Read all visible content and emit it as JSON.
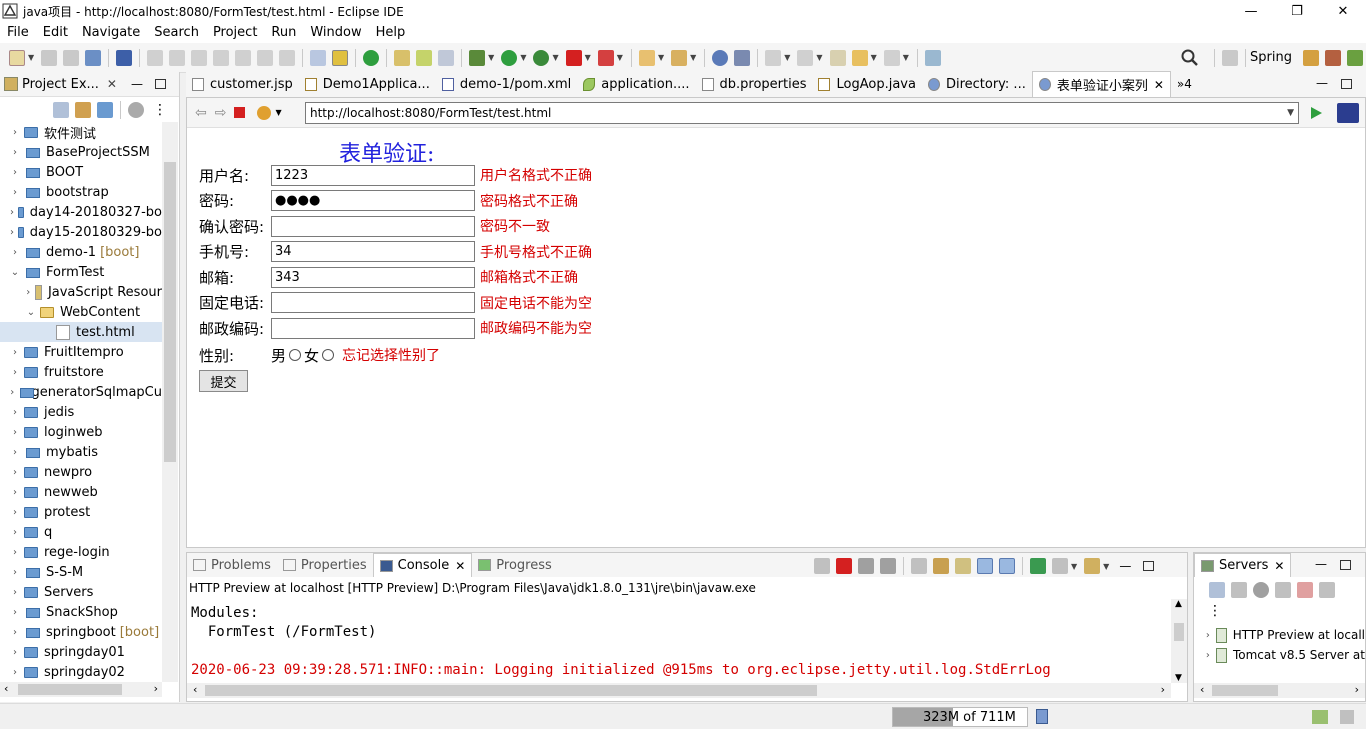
{
  "window": {
    "title": "java项目 - http://localhost:8080/FormTest/test.html - Eclipse IDE",
    "minimize": "—",
    "restore": "❐",
    "close": "✕"
  },
  "menu": [
    "File",
    "Edit",
    "Navigate",
    "Search",
    "Project",
    "Run",
    "Window",
    "Help"
  ],
  "perspective": {
    "label": "Spring"
  },
  "left_view": {
    "tab": "Project Ex...",
    "items": [
      {
        "label": "软件测试",
        "type": "folder",
        "twisty": "›"
      },
      {
        "label": "BaseProjectSSM",
        "type": "project",
        "twisty": "›"
      },
      {
        "label": "BOOT",
        "type": "project",
        "twisty": "›"
      },
      {
        "label": "bootstrap",
        "type": "project",
        "twisty": "›"
      },
      {
        "label": "day14-20180327-bo",
        "type": "folder",
        "twisty": "›"
      },
      {
        "label": "day15-20180329-bo",
        "type": "folder",
        "twisty": "›"
      },
      {
        "label": "demo-1",
        "suffix": "[boot]",
        "type": "project",
        "twisty": "›"
      },
      {
        "label": "FormTest",
        "type": "project",
        "twisty": "⌄"
      },
      {
        "label": "JavaScript Resour",
        "type": "jsres",
        "twisty": "›",
        "indent": 1
      },
      {
        "label": "WebContent",
        "type": "openfolder",
        "twisty": "⌄",
        "indent": 1
      },
      {
        "label": "test.html",
        "type": "file",
        "twisty": "",
        "indent": 2,
        "selected": true
      },
      {
        "label": "FruitItempro",
        "type": "folder",
        "twisty": "›"
      },
      {
        "label": "fruitstore",
        "type": "folder",
        "twisty": "›"
      },
      {
        "label": "generatorSqlmapCu",
        "type": "project",
        "twisty": "›"
      },
      {
        "label": "jedis",
        "type": "folder",
        "twisty": "›"
      },
      {
        "label": "loginweb",
        "type": "folder",
        "twisty": "›"
      },
      {
        "label": "mybatis",
        "type": "project",
        "twisty": "›"
      },
      {
        "label": "newpro",
        "type": "folder",
        "twisty": "›"
      },
      {
        "label": "newweb",
        "type": "folder",
        "twisty": "›"
      },
      {
        "label": "protest",
        "type": "folder",
        "twisty": "›"
      },
      {
        "label": "q",
        "type": "folder",
        "twisty": "›"
      },
      {
        "label": "rege-login",
        "type": "folder",
        "twisty": "›"
      },
      {
        "label": "S-S-M",
        "type": "project",
        "twisty": "›"
      },
      {
        "label": "Servers",
        "type": "folder",
        "twisty": "›"
      },
      {
        "label": "SnackShop",
        "type": "project",
        "twisty": "›"
      },
      {
        "label": "springboot",
        "suffix": "[boot]",
        "type": "project",
        "twisty": "›"
      },
      {
        "label": "springday01",
        "type": "folder",
        "twisty": "›"
      },
      {
        "label": "springday02",
        "type": "folder",
        "twisty": "›"
      }
    ]
  },
  "editor_tabs": [
    {
      "label": "customer.jsp",
      "active": false
    },
    {
      "label": "Demo1Applica...",
      "active": false
    },
    {
      "label": "demo-1/pom.xml",
      "active": false
    },
    {
      "label": "application....",
      "active": false
    },
    {
      "label": "db.properties",
      "active": false
    },
    {
      "label": "LogAop.java",
      "active": false
    },
    {
      "label": "Directory: ...",
      "active": false
    },
    {
      "label": "表单验证小案列",
      "active": true
    }
  ],
  "editor_overflow": "»4",
  "browser": {
    "url": "http://localhost:8080/FormTest/test.html"
  },
  "form": {
    "title": "表单验证:",
    "fields": [
      {
        "label": "用户名:",
        "value": "1223",
        "error": "用户名格式不正确"
      },
      {
        "label": "密码:",
        "value": "●●●●",
        "error": "密码格式不正确"
      },
      {
        "label": "确认密码:",
        "value": "",
        "error": "密码不一致"
      },
      {
        "label": "手机号:",
        "value": "34",
        "error": "手机号格式不正确"
      },
      {
        "label": "邮箱:",
        "value": "343",
        "error": "邮箱格式不正确"
      },
      {
        "label": "固定电话:",
        "value": "",
        "error": "固定电话不能为空"
      },
      {
        "label": "邮政编码:",
        "value": "",
        "error": "邮政编码不能为空"
      }
    ],
    "gender": {
      "label": "性别:",
      "male": "男",
      "female": "女",
      "error": "忘记选择性别了"
    },
    "submit": "提交"
  },
  "console": {
    "tabs": [
      "Problems",
      "Properties",
      "Console",
      "Progress"
    ],
    "active_tab": "Console",
    "description": "HTTP Preview at localhost [HTTP Preview] D:\\Program Files\\Java\\jdk1.8.0_131\\jre\\bin\\javaw.exe",
    "lines": [
      {
        "text": "Modules:",
        "color": "black"
      },
      {
        "text": "  FormTest (/FormTest)",
        "color": "black"
      },
      {
        "text": "",
        "color": "black"
      },
      {
        "text": "2020-06-23 09:39:28.571:INFO::main: Logging initialized @915ms to org.eclipse.jetty.util.log.StdErrLog",
        "color": "red"
      }
    ]
  },
  "servers": {
    "tab": "Servers",
    "items": [
      "HTTP Preview at locall",
      "Tomcat v8.5 Server at"
    ]
  },
  "status": {
    "heap_used": "323M",
    "heap_of": "of 711M",
    "heap_fraction": 0.45
  },
  "colors": {
    "form_title": "#2222dd",
    "error": "#d40000",
    "console_error": "#d40000"
  }
}
